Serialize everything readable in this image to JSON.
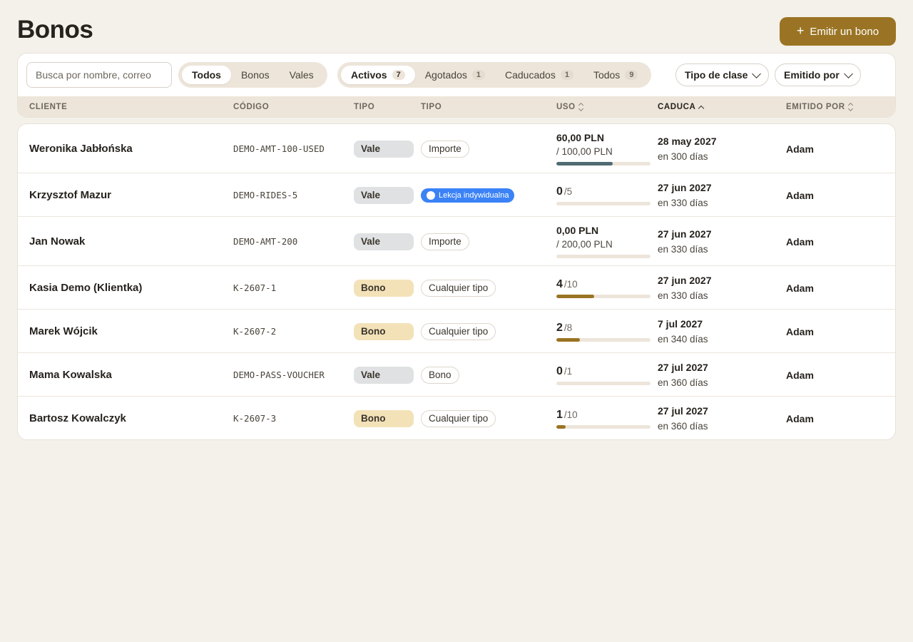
{
  "page": {
    "title": "Bonos",
    "emit_button": "Emitir un bono",
    "emit_icon": "plus-icon"
  },
  "filters": {
    "search_placeholder": "Busca por nombre, correo",
    "kind_tabs": [
      {
        "label": "Todos",
        "active": true
      },
      {
        "label": "Bonos",
        "active": false
      },
      {
        "label": "Vales",
        "active": false
      }
    ],
    "status_tabs": [
      {
        "label": "Activos",
        "count": "7",
        "active": true
      },
      {
        "label": "Agotados",
        "count": "1",
        "active": false
      },
      {
        "label": "Caducados",
        "count": "1",
        "active": false
      },
      {
        "label": "Todos",
        "count": "9",
        "active": false
      }
    ],
    "class_type_dropdown": "Tipo de clase",
    "issued_by_dropdown": "Emitido por"
  },
  "columns": {
    "client": "CLIENTE",
    "code": "CÓDIGO",
    "type1": "TIPO",
    "type2": "TIPO",
    "usage": "USO",
    "expires": "CADUCA",
    "issued_by": "EMITIDO POR"
  },
  "colors": {
    "accent": "#9a7424",
    "progress_gold": "#9a7424",
    "progress_slate": "#4f6b73",
    "class_chip_blue": "#3b82f6"
  },
  "rows": [
    {
      "client": "Weronika Jabłońska",
      "code": "DEMO-AMT-100-USED",
      "type1": "Vale",
      "type1_kind": "vale",
      "type2": "Importe",
      "type2_kind": "outline",
      "usage_main": "60,00 PLN",
      "usage_total": "",
      "usage_sub": "/ 100,00 PLN",
      "usage_fraction": 0.6,
      "bar_color": "#4f6b73",
      "expires_date": "28 may 2027",
      "expires_rel": "en 300 días",
      "issued_by": "Adam"
    },
    {
      "client": "Krzysztof Mazur",
      "code": "DEMO-RIDES-5",
      "type1": "Vale",
      "type1_kind": "vale",
      "type2": "Lekcja indywidualna",
      "type2_kind": "class",
      "usage_main": "0",
      "usage_total": "/5",
      "usage_sub": "",
      "usage_fraction": 0,
      "bar_color": "#9a7424",
      "expires_date": "27 jun 2027",
      "expires_rel": "en 330 días",
      "issued_by": "Adam"
    },
    {
      "client": "Jan Nowak",
      "code": "DEMO-AMT-200",
      "type1": "Vale",
      "type1_kind": "vale",
      "type2": "Importe",
      "type2_kind": "outline",
      "usage_main": "0,00 PLN",
      "usage_total": "",
      "usage_sub": "/ 200,00 PLN",
      "usage_fraction": 0,
      "bar_color": "#4f6b73",
      "expires_date": "27 jun 2027",
      "expires_rel": "en 330 días",
      "issued_by": "Adam"
    },
    {
      "client": "Kasia Demo (Klientka)",
      "code": "K-2607-1",
      "type1": "Bono",
      "type1_kind": "bono",
      "type2": "Cualquier tipo",
      "type2_kind": "outline",
      "usage_main": "4",
      "usage_total": "/10",
      "usage_sub": "",
      "usage_fraction": 0.4,
      "bar_color": "#9a7424",
      "expires_date": "27 jun 2027",
      "expires_rel": "en 330 días",
      "issued_by": "Adam"
    },
    {
      "client": "Marek Wójcik",
      "code": "K-2607-2",
      "type1": "Bono",
      "type1_kind": "bono",
      "type2": "Cualquier tipo",
      "type2_kind": "outline",
      "usage_main": "2",
      "usage_total": "/8",
      "usage_sub": "",
      "usage_fraction": 0.25,
      "bar_color": "#9a7424",
      "expires_date": "7 jul 2027",
      "expires_rel": "en 340 días",
      "issued_by": "Adam"
    },
    {
      "client": "Mama Kowalska",
      "code": "DEMO-PASS-VOUCHER",
      "type1": "Vale",
      "type1_kind": "vale",
      "type2": "Bono",
      "type2_kind": "outline",
      "usage_main": "0",
      "usage_total": "/1",
      "usage_sub": "",
      "usage_fraction": 0,
      "bar_color": "#9a7424",
      "expires_date": "27 jul 2027",
      "expires_rel": "en 360 días",
      "issued_by": "Adam"
    },
    {
      "client": "Bartosz Kowalczyk",
      "code": "K-2607-3",
      "type1": "Bono",
      "type1_kind": "bono",
      "type2": "Cualquier tipo",
      "type2_kind": "outline",
      "usage_main": "1",
      "usage_total": "/10",
      "usage_sub": "",
      "usage_fraction": 0.1,
      "bar_color": "#9a7424",
      "expires_date": "27 jul 2027",
      "expires_rel": "en 360 días",
      "issued_by": "Adam"
    }
  ]
}
